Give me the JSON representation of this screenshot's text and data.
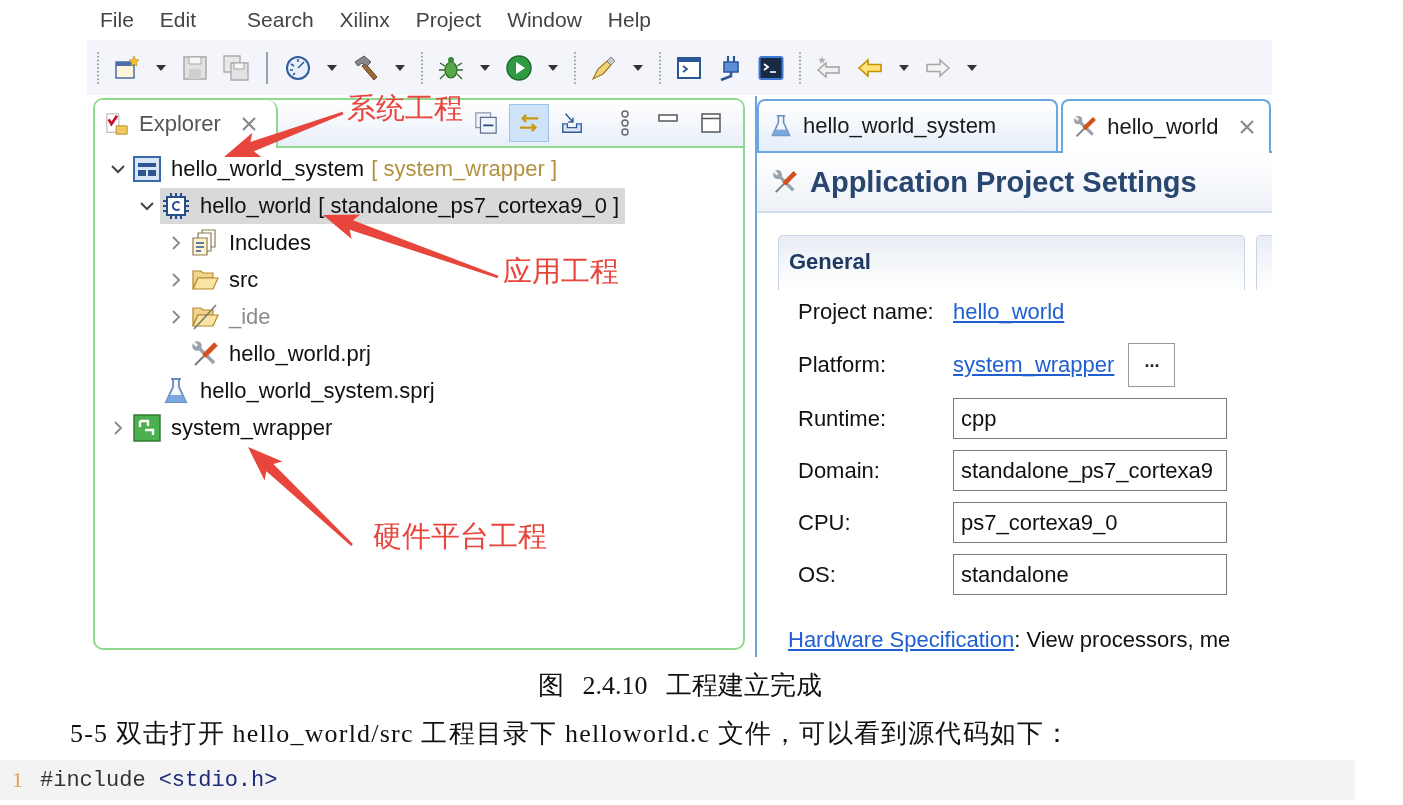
{
  "menu": [
    {
      "label": "File"
    },
    {
      "label": "Edit"
    },
    {
      "label": "Search"
    },
    {
      "label": "Xilinx"
    },
    {
      "label": "Project"
    },
    {
      "label": "Window"
    },
    {
      "label": "Help"
    }
  ],
  "explorer": {
    "tab": {
      "label": "Explorer"
    },
    "tools": [
      {
        "kind": "collapse",
        "on": false
      },
      {
        "kind": "link",
        "on": true
      },
      {
        "kind": "import",
        "on": false
      }
    ],
    "tree": [
      {
        "kind": "system-project",
        "label": "hello_world_system",
        "detail": "[ system_wrapper ]",
        "expanded": true,
        "selected": false,
        "greyed": false,
        "children": [
          {
            "kind": "app-project",
            "label": "hello_world",
            "detail": "[ standalone_ps7_cortexa9_0 ]",
            "expanded": true,
            "selected": true,
            "greyed": false,
            "children": [
              {
                "kind": "includes",
                "label": "Includes",
                "expanded": false,
                "selected": false,
                "greyed": false
              },
              {
                "kind": "folder",
                "label": "src",
                "expanded": false,
                "selected": false,
                "greyed": false
              },
              {
                "kind": "folder-excluded",
                "label": "_ide",
                "expanded": false,
                "selected": false,
                "greyed": true
              },
              {
                "kind": "settings-file",
                "label": "hello_world.prj",
                "selected": false,
                "greyed": false
              }
            ]
          },
          {
            "kind": "system-file",
            "label": "hello_world_system.sprj",
            "selected": false,
            "greyed": false
          }
        ]
      },
      {
        "kind": "platform",
        "label": "system_wrapper",
        "expanded": false,
        "selected": false,
        "greyed": false
      }
    ]
  },
  "editor": {
    "tabs": [
      {
        "kind": "system",
        "label": "hello_world_system",
        "selected": false
      },
      {
        "kind": "application",
        "label": "hello_world",
        "selected": true
      }
    ],
    "title": "Application Project Settings",
    "section": "General",
    "fields": [
      {
        "kind": "link",
        "label": "Project name:",
        "value": "hello_world"
      },
      {
        "kind": "link",
        "label": "Platform:",
        "value": "system_wrapper",
        "button": "..."
      },
      {
        "kind": "text",
        "label": "Runtime:",
        "value": "cpp"
      },
      {
        "kind": "text",
        "label": "Domain:",
        "value": "standalone_ps7_cortexa9"
      },
      {
        "kind": "text",
        "label": "CPU:",
        "value": "ps7_cortexa9_0"
      },
      {
        "kind": "text",
        "label": "OS:",
        "value": "standalone"
      }
    ],
    "footer": {
      "link": "Hardware Specification",
      "text": ": View processors, me"
    }
  },
  "annotations": [
    {
      "text": "系统工程"
    },
    {
      "text": "应用工程"
    },
    {
      "text": "硬件平台工程"
    }
  ],
  "caption": "图 2.4.10 工程建立完成",
  "paragraph": "5-5 双击打开 hello_world/src 工程目录下 helloworld.c 文件，可以看到源代码如下：",
  "code": [
    {
      "number": "1",
      "tokens": [
        {
          "kind": "directive",
          "text": "#include"
        },
        {
          "kind": "header",
          "text": "<stdio.h>"
        }
      ]
    }
  ]
}
